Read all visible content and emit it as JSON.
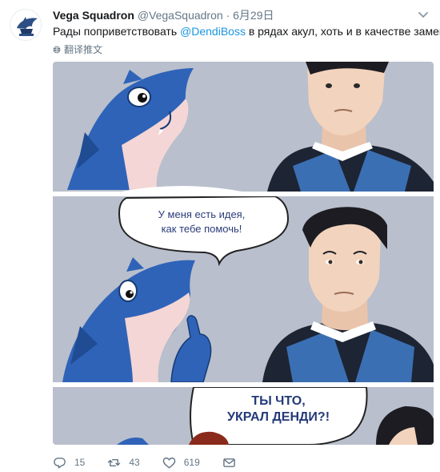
{
  "tweet": {
    "display_name": "Vega Squadron",
    "handle": "@VegaSquadron",
    "separator": "·",
    "date": "6月29日",
    "text_before": "Рады поприветствовать ",
    "mention": "@DendiBoss",
    "text_after": " в рядах акул, хоть и в качестве замены.",
    "translate_label": "翻译推文"
  },
  "comic": {
    "panel2_bubble": "У меня есть идея, как тебе помочь!",
    "panel2_line1": "У меня есть идея,",
    "panel2_line2": "как тебе помочь!",
    "panel3_line1": "ТЫ ЧТО,",
    "panel3_line2": "УКРАЛ ДЕНДИ?!",
    "colors": {
      "panel_bg": "#b9bfcc",
      "shark_blue": "#2f63b8",
      "shark_belly": "#f4d6d6",
      "jersey_dark": "#1d2433",
      "jersey_blue": "#3b6fb3",
      "skin": "#f2d3bd",
      "hair": "#1c1c22"
    }
  },
  "actions": {
    "reply_count": "15",
    "retweet_count": "43",
    "like_count": "619"
  },
  "icons": [
    "vega-logo",
    "chevron-down-icon",
    "globe-icon",
    "reply-icon",
    "retweet-icon",
    "like-icon",
    "direct-message-icon"
  ]
}
